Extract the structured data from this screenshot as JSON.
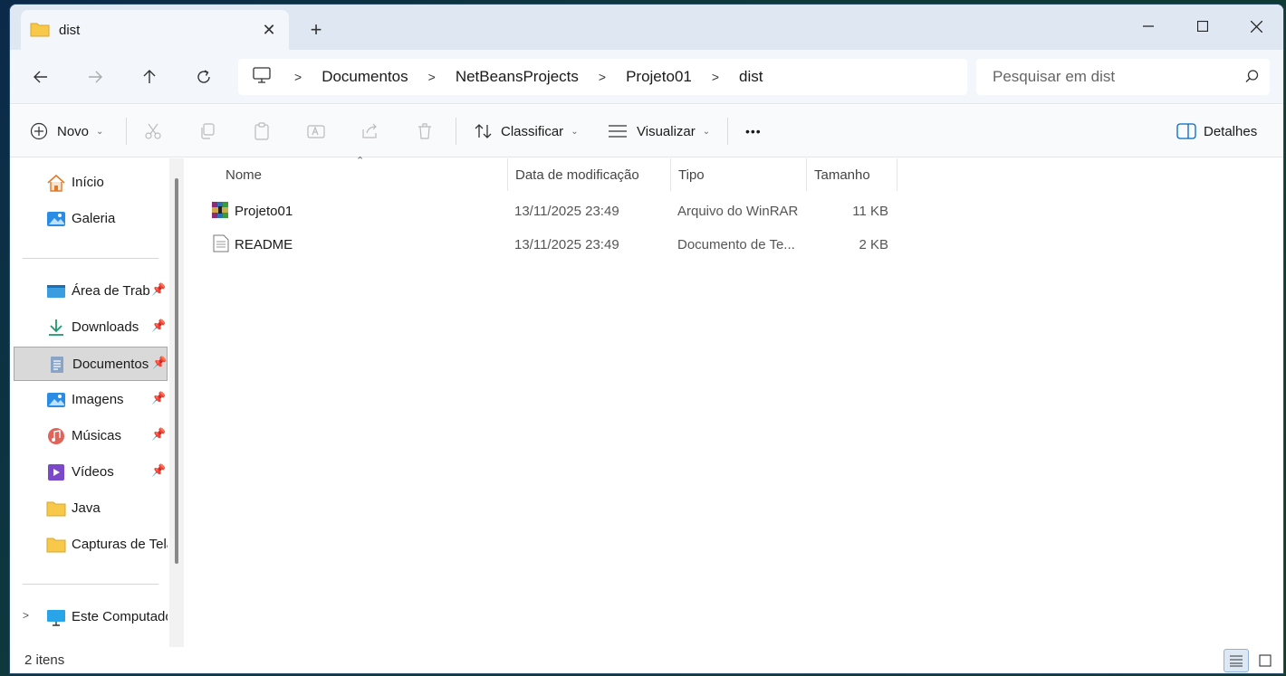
{
  "window": {
    "tab_title": "dist",
    "new_tab": "+",
    "close_tab": "✕"
  },
  "address": {
    "crumbs": [
      "Documentos",
      "NetBeansProjects",
      "Projeto01",
      "dist"
    ],
    "search_placeholder": "Pesquisar em dist"
  },
  "toolbar": {
    "new_label": "Novo",
    "sort_label": "Classificar",
    "view_label": "Visualizar",
    "more_label": "•••",
    "details_label": "Detalhes"
  },
  "sidebar": {
    "items": [
      {
        "label": "Início",
        "icon": "home-icon"
      },
      {
        "label": "Galeria",
        "icon": "gallery-icon"
      },
      {
        "label": "Área de Trab",
        "icon": "desktop-icon",
        "pinned": true
      },
      {
        "label": "Downloads",
        "icon": "download-icon",
        "pinned": true
      },
      {
        "label": "Documentos",
        "icon": "documents-icon",
        "pinned": true,
        "selected": true
      },
      {
        "label": "Imagens",
        "icon": "pictures-icon",
        "pinned": true
      },
      {
        "label": "Músicas",
        "icon": "music-icon",
        "pinned": true
      },
      {
        "label": "Vídeos",
        "icon": "videos-icon",
        "pinned": true
      },
      {
        "label": "Java",
        "icon": "folder-icon"
      },
      {
        "label": "Capturas de Tela",
        "icon": "folder-icon"
      },
      {
        "label": "Este Computador",
        "icon": "computer-icon"
      }
    ]
  },
  "list": {
    "columns": {
      "name": "Nome",
      "modified": "Data de modificação",
      "type": "Tipo",
      "size": "Tamanho"
    },
    "rows": [
      {
        "name": "Projeto01",
        "modified": "13/11/2025 23:49",
        "type": "Arquivo do WinRAR",
        "size": "11 KB",
        "icon": "winrar-icon"
      },
      {
        "name": "README",
        "modified": "13/11/2025 23:49",
        "type": "Documento de Te...",
        "size": "2 KB",
        "icon": "text-document-icon"
      }
    ]
  },
  "status": {
    "count": "2 itens"
  },
  "colors": {
    "accent": "#0067c0",
    "folder": "#f8c84a",
    "titlebar": "#dfe8f2"
  }
}
